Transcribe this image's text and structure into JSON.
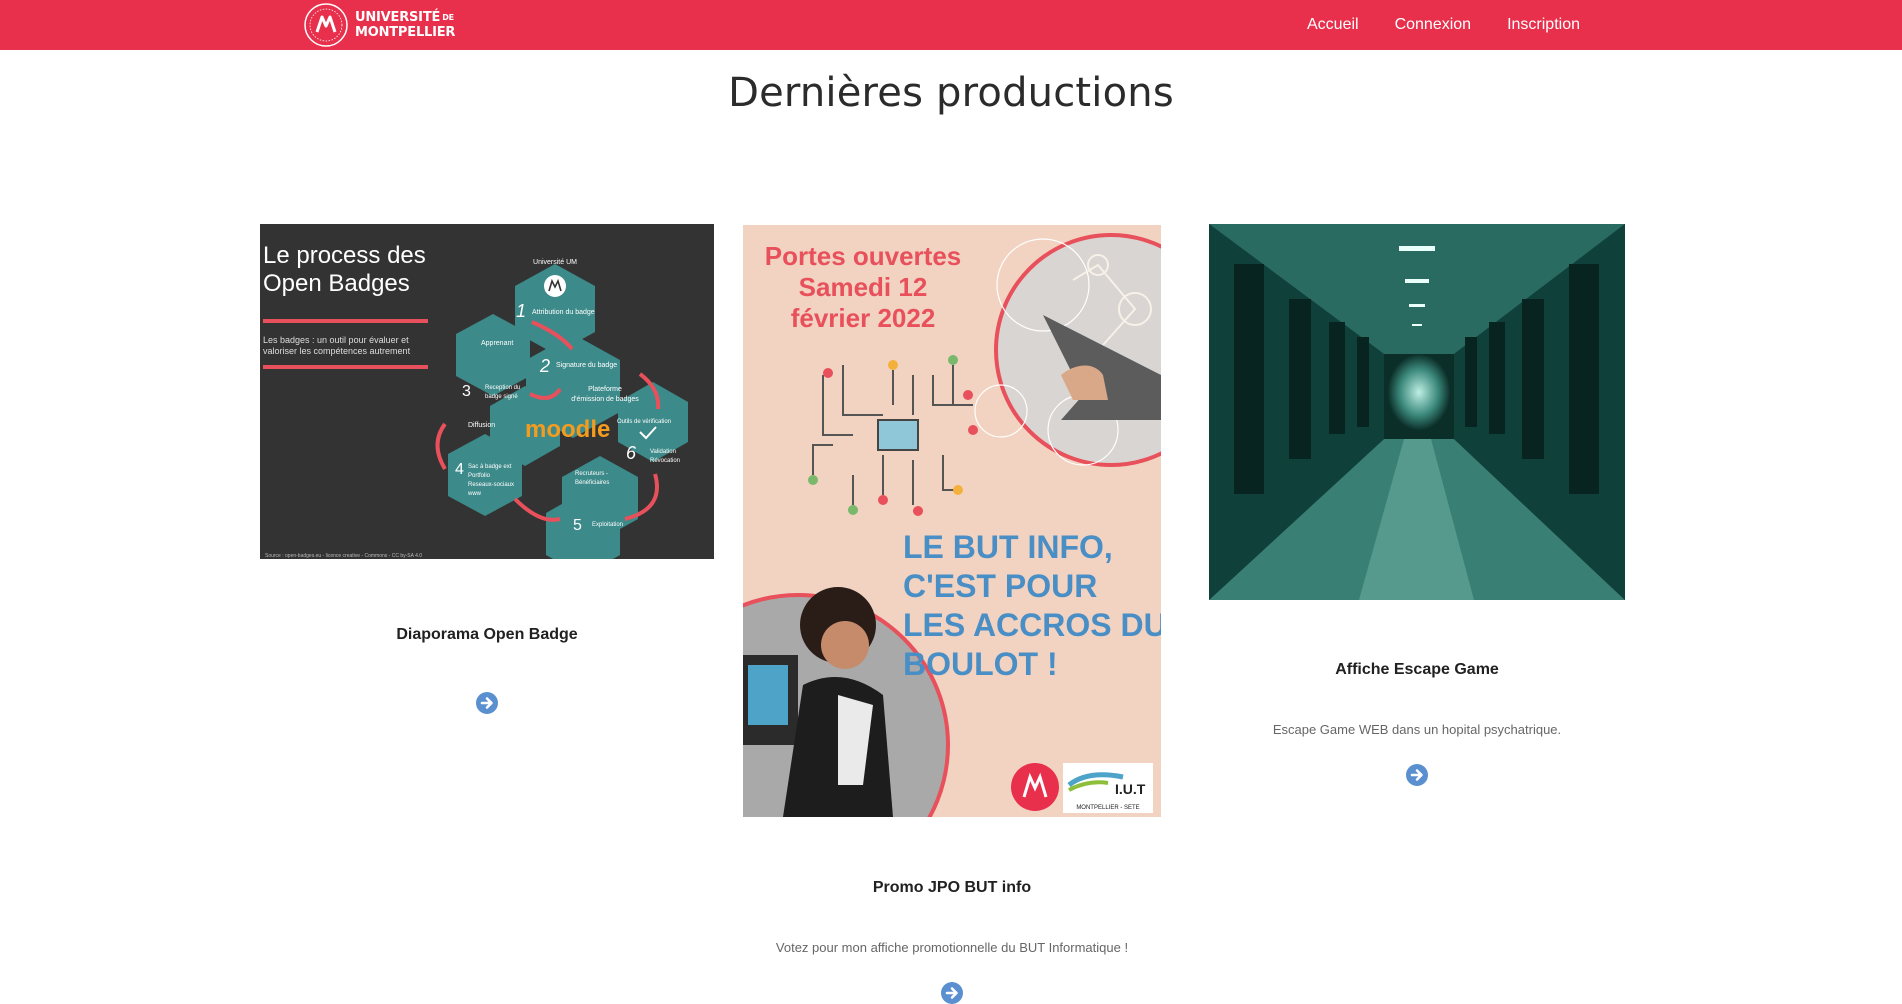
{
  "navbar": {
    "brand_line1": "UNIVERSITÉ",
    "brand_de": "DE",
    "brand_line2": "MONTPELLIER",
    "links": [
      "Accueil",
      "Connexion",
      "Inscription"
    ],
    "color": "#e8304d"
  },
  "main": {
    "title": "Dernières productions",
    "cards": [
      {
        "title": "Diaporama Open Badge",
        "description": "",
        "image": {
          "heading_line1": "Le process des",
          "heading_line2": "Open Badges",
          "subtitle_line1": "Les badges : un outil pour évaluer et",
          "subtitle_line2": "valoriser les compétences autrement",
          "university": "Université UM",
          "step1": "Attribution du badge",
          "apprenant": "Apprenant",
          "step2": "Signature du badge",
          "step3_line1": "Reception du",
          "step3_line2": "badge signé",
          "plateforme_line1": "Plateforme",
          "plateforme_line2": "d'émission de badges",
          "moodle": "moodle",
          "outils": "Outils de vérification",
          "diffusion": "Diffusion",
          "step4_line1": "Sac à badge ext",
          "step4_line2": "Portfolio",
          "step4_line3": "Reseaux-sociaux",
          "step4_line4": "www",
          "step6_line1": "Validation",
          "step6_line2": "Révocation",
          "recruteurs_line1": "Recruteurs -",
          "recruteurs_line2": "Bénéficiaires",
          "step5": "Exploitation",
          "source": "Source : open-badges.eu - licence creative - Commons - CC by-SA 4.0"
        }
      },
      {
        "title": "Promo JPO BUT info",
        "description": "Votez pour mon affiche promotionnelle du BUT Informatique !",
        "image": {
          "line1": "Portes ouvertes",
          "line2": "Samedi 12",
          "line3": "février 2022",
          "slogan_line1": "LE BUT INFO,",
          "slogan_line2": "C'EST  POUR",
          "slogan_line3": "LES ACCROS DU",
          "slogan_line4": "BOULOT !",
          "iut": "I.U.T",
          "iut_sub": "MONTPELLIER - SETE"
        }
      },
      {
        "title": "Affiche Escape Game",
        "description": "Escape Game WEB dans un hopital psychatrique."
      }
    ]
  }
}
